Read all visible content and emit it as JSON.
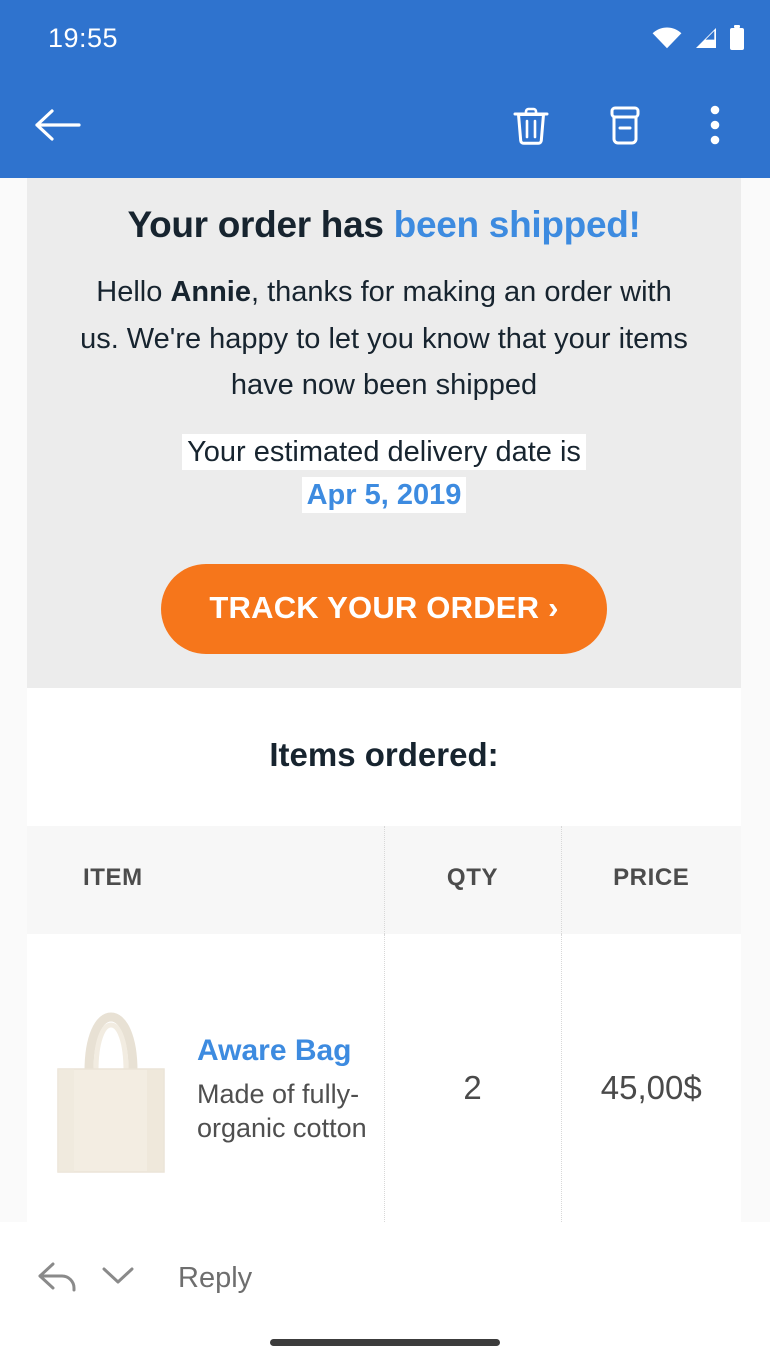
{
  "status_bar": {
    "time": "19:55",
    "icons": [
      "wifi-icon",
      "cell-signal-icon",
      "battery-icon"
    ]
  },
  "toolbar": {
    "back_icon": "back-arrow-icon",
    "delete_icon": "trash-icon",
    "archive_icon": "archive-icon",
    "overflow_icon": "more-vertical-icon"
  },
  "email": {
    "hero": {
      "headline_plain": "Your order has ",
      "headline_accent": "been shipped!",
      "lede_before": "Hello ",
      "lede_name": "Annie",
      "lede_after": ", thanks for making an order with us. We're happy to let you know that your items have now been shipped",
      "delivery_label": "Your estimated delivery date is",
      "delivery_date": "Apr 5, 2019",
      "cta_label": "TRACK YOUR ORDER ›"
    },
    "items_heading": "Items ordered:",
    "table": {
      "columns": [
        "ITEM",
        "QTY",
        "PRICE"
      ],
      "rows": [
        {
          "image": "tote-bag-image",
          "name": "Aware Bag",
          "description": "Made of fully-organic cotton",
          "qty": "2",
          "price": "45,00$"
        }
      ]
    }
  },
  "reply_bar": {
    "reply_icon": "reply-arrow-icon",
    "dropdown_icon": "chevron-down-icon",
    "label": "Reply"
  },
  "colors": {
    "app_bar": "#2f73ce",
    "accent_blue": "#3d8be0",
    "cta_orange": "#f6761b",
    "hero_bg": "#ececec",
    "text_dark": "#17242f"
  }
}
